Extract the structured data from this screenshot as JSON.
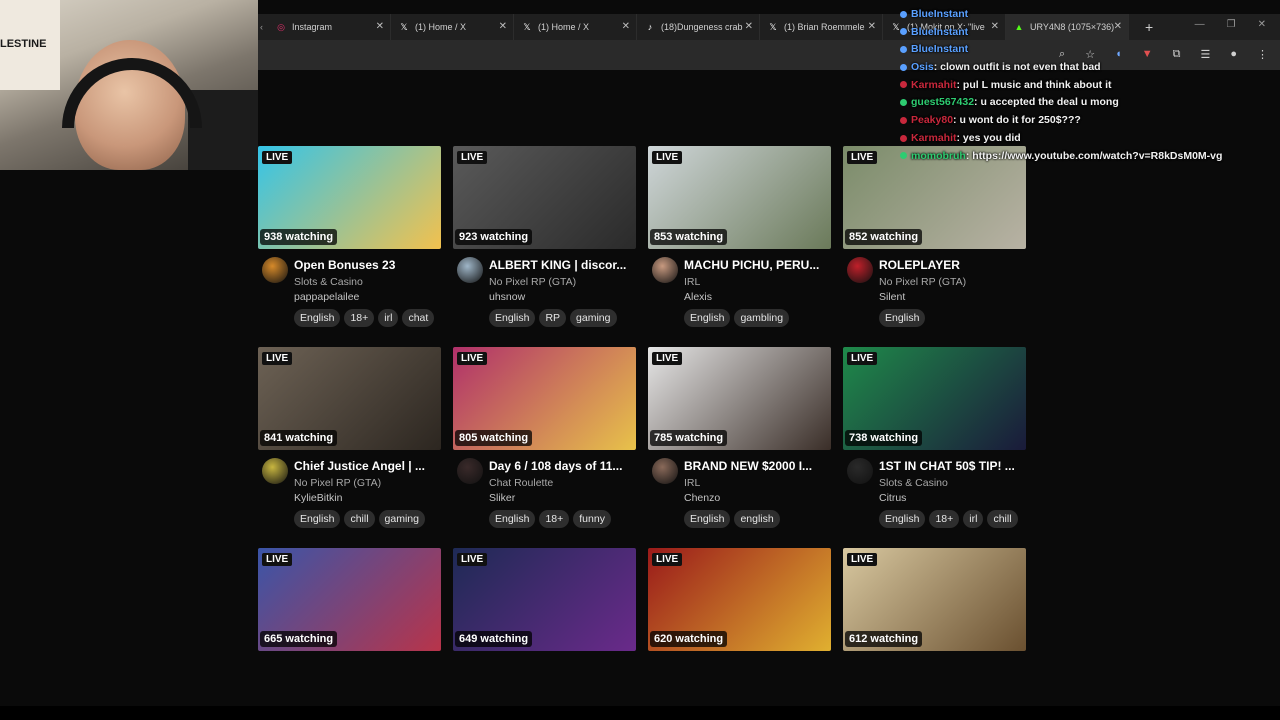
{
  "tabs": [
    {
      "label": "Instagram",
      "icon": "instagram-icon",
      "glyph": "◎",
      "color": "#e1306c"
    },
    {
      "label": "(1) Home / X",
      "icon": "x-icon",
      "glyph": "𝕏",
      "color": "#ffffff"
    },
    {
      "label": "(1) Home / X",
      "icon": "x-icon",
      "glyph": "𝕏",
      "color": "#ffffff"
    },
    {
      "label": "(18)Dungeness crab",
      "icon": "tiktok-icon",
      "glyph": "♪",
      "color": "#ffffff"
    },
    {
      "label": "(1) Brian Roemmele",
      "icon": "x-icon",
      "glyph": "𝕏",
      "color": "#ffffff"
    },
    {
      "label": "(1) Mokit on X: \"live",
      "icon": "x-icon",
      "glyph": "𝕏",
      "color": "#ffffff"
    },
    {
      "label": "URY4N8 (1075×736)",
      "icon": "kick-icon",
      "glyph": "▲",
      "color": "#53fc18"
    }
  ],
  "chat": [
    {
      "user": "BlueInstant",
      "msg": "",
      "color": "#5aa0ff"
    },
    {
      "user": "BlueInstant",
      "msg": "",
      "color": "#5aa0ff"
    },
    {
      "user": "BlueInstant",
      "msg": "",
      "color": "#5aa0ff"
    },
    {
      "user": "Osis",
      "msg": ": clown outfit is not even that bad",
      "color": "#5aa0ff"
    },
    {
      "user": "Karmahit",
      "msg": ": pul L music and think about it",
      "color": "#c8283c"
    },
    {
      "user": "guest567432",
      "msg": ": u accepted the deal u mong",
      "color": "#2ecc71"
    },
    {
      "user": "Peaky80",
      "msg": ": u wont do it for 250$???",
      "color": "#c8283c"
    },
    {
      "user": "Karmahit",
      "msg": ": yes you did",
      "color": "#c8283c"
    },
    {
      "user": "momobruh",
      "msg": ": https://www.youtube.com/watch?v=R8kDsM0M-vg",
      "color": "#2ecc71"
    }
  ],
  "live_label": "LIVE",
  "streams": [
    {
      "watching": "938 watching",
      "title": "Open Bonuses 23",
      "category": "Slots & Casino",
      "streamer": "pappapelailee",
      "tags": [
        "English",
        "18+",
        "irl",
        "chat"
      ],
      "thumb": [
        "#34c4e8",
        "#f2c14e"
      ],
      "avatar": "#d68a2a"
    },
    {
      "watching": "923 watching",
      "title": "ALBERT KING | discor...",
      "category": "No Pixel RP (GTA)",
      "streamer": "uhsnow",
      "tags": [
        "English",
        "RP",
        "gaming"
      ],
      "thumb": [
        "#5a5a5a",
        "#2a2a2a"
      ],
      "avatar": "#9fb6c8"
    },
    {
      "watching": "853 watching",
      "title": "MACHU PICHU, PERU...",
      "category": "IRL",
      "streamer": "Alexis",
      "tags": [
        "English",
        "gambling"
      ],
      "thumb": [
        "#cfd6d9",
        "#6b7a5a"
      ],
      "avatar": "#c89a80"
    },
    {
      "watching": "852 watching",
      "title": "ROLEPLAYER",
      "category": "No Pixel RP (GTA)",
      "streamer": "Silent",
      "tags": [
        "English"
      ],
      "thumb": [
        "#7b8c6a",
        "#b8b2a4"
      ],
      "avatar": "#c0202a"
    },
    {
      "watching": "841 watching",
      "title": "Chief Justice Angel | ...",
      "category": "No Pixel RP (GTA)",
      "streamer": "KylieBitkin",
      "tags": [
        "English",
        "chill",
        "gaming"
      ],
      "thumb": [
        "#6d6255",
        "#2c2620"
      ],
      "avatar": "#c8b640"
    },
    {
      "watching": "805 watching",
      "title": "Day 6 / 108 days of 11...",
      "category": "Chat Roulette",
      "streamer": "Sliker",
      "tags": [
        "English",
        "18+",
        "funny"
      ],
      "thumb": [
        "#b0306a",
        "#e8c24a"
      ],
      "avatar": "#3a2a2a"
    },
    {
      "watching": "785 watching",
      "title": "BRAND NEW $2000 I...",
      "category": "IRL",
      "streamer": "Chenzo",
      "tags": [
        "English",
        "english"
      ],
      "thumb": [
        "#e6e6e6",
        "#3a2e28"
      ],
      "avatar": "#8a6a5a"
    },
    {
      "watching": "738 watching",
      "title": "1ST IN CHAT 50$ TIP! ...",
      "category": "Slots & Casino",
      "streamer": "Citrus",
      "tags": [
        "English",
        "18+",
        "irl",
        "chill"
      ],
      "thumb": [
        "#1f8a4a",
        "#1a1a3a"
      ],
      "avatar": "#2a2a2a"
    },
    {
      "watching": "665 watching",
      "title": "",
      "category": "",
      "streamer": "",
      "tags": [],
      "thumb": [
        "#3a55a8",
        "#b8344a"
      ],
      "avatar": "#444"
    },
    {
      "watching": "649 watching",
      "title": "",
      "category": "",
      "streamer": "",
      "tags": [],
      "thumb": [
        "#1e2a55",
        "#6a2a8a"
      ],
      "avatar": "#444"
    },
    {
      "watching": "620 watching",
      "title": "",
      "category": "",
      "streamer": "",
      "tags": [],
      "thumb": [
        "#9a1a1a",
        "#e0b030"
      ],
      "avatar": "#444"
    },
    {
      "watching": "612 watching",
      "title": "",
      "category": "",
      "streamer": "",
      "tags": [],
      "thumb": [
        "#d8c8a0",
        "#6a5030"
      ],
      "avatar": "#444"
    }
  ]
}
